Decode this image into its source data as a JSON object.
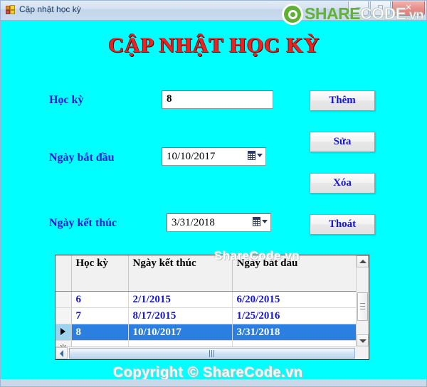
{
  "window": {
    "title": "Cập nhật học kỳ",
    "icon": "form-app-icon",
    "buttons": {
      "minimize": "–",
      "maximize": "□",
      "close": "✕"
    }
  },
  "brand": {
    "logo_icon": "sharecode-logo-icon",
    "share": "SHARE",
    "code": "CODE",
    "vn": ".vn"
  },
  "form": {
    "heading": "CẬP NHẬT HỌC KỲ",
    "fields": [
      {
        "label": "Học kỳ",
        "value": "8"
      },
      {
        "label": "Ngày bắt đầu",
        "value": "10/10/2017"
      },
      {
        "label": "Ngày kết thúc",
        "value": "3/31/2018"
      }
    ]
  },
  "buttons": [
    {
      "label": "Thêm"
    },
    {
      "label": "Sửa"
    },
    {
      "label": "Xóa"
    },
    {
      "label": "Thoát"
    }
  ],
  "grid": {
    "headers": [
      "Học kỳ",
      "Ngày kết thúc",
      "Ngày bắt đầu"
    ],
    "rows": [
      {
        "hoc_ky": "6",
        "ngay_ket_thuc": "2/1/2015",
        "ngay_bat_dau": "6/20/2015",
        "selected": false
      },
      {
        "hoc_ky": "7",
        "ngay_ket_thuc": "8/17/2015",
        "ngay_bat_dau": "1/25/2016",
        "selected": false
      },
      {
        "hoc_ky": "8",
        "ngay_ket_thuc": "10/10/2017",
        "ngay_bat_dau": "3/31/2018",
        "selected": true
      }
    ],
    "new_row_glyph": "✳"
  },
  "watermarks": {
    "grid": "ShareCode.vn",
    "footer": "Copyright © ShareCode.vn"
  },
  "colors": {
    "form_background": "#00ffff",
    "heading": "#ef2020",
    "label": "#1616d6",
    "grid_selection": "#2a7fe0",
    "titlebar": "#cadbee"
  }
}
